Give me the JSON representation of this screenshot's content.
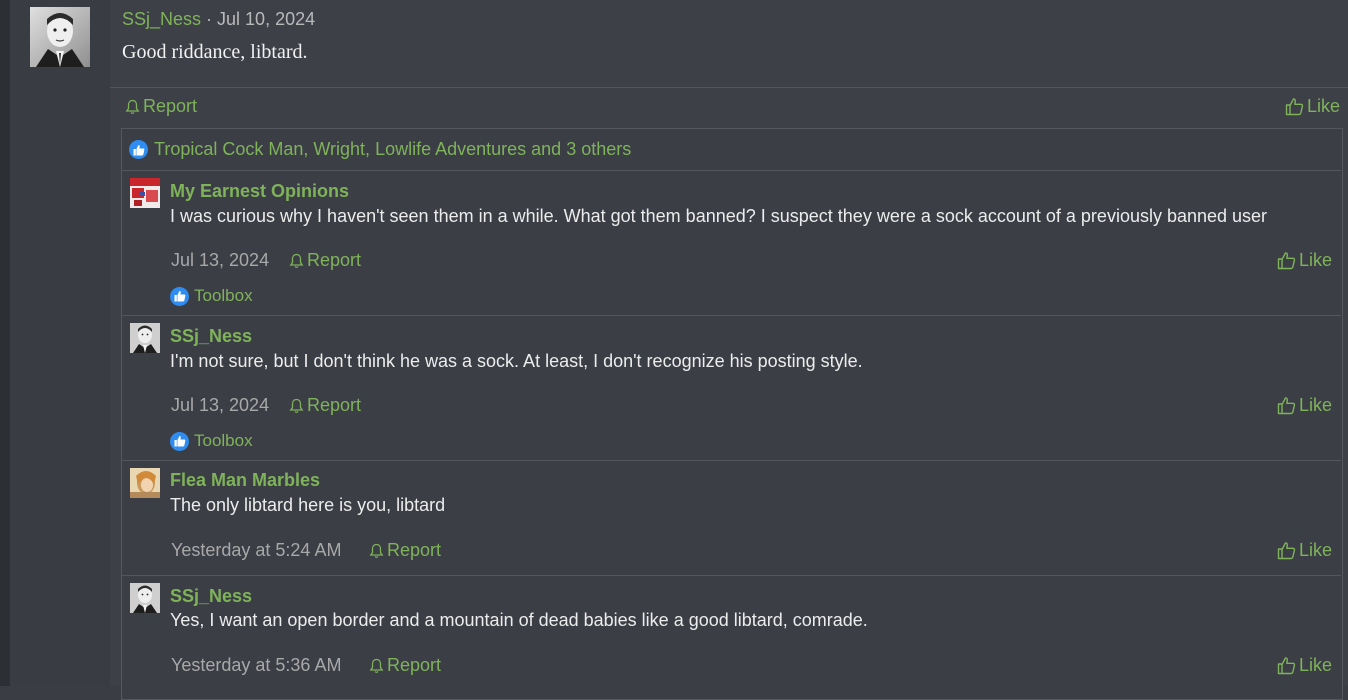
{
  "post": {
    "author": "SSj_Ness",
    "separator": " · ",
    "date": "Jul 10, 2024",
    "body": "Good riddance, libtard.",
    "report_label": "Report",
    "like_label": "Like"
  },
  "likes_summary": {
    "text": "Tropical Cock Man, Wright, Lowlife Adventures and 3 others"
  },
  "comments": [
    {
      "author": "My Earnest Opinions",
      "text": "I was curious why I haven't seen them in a while. What got them banned? I suspect they were a sock account of a previously banned user",
      "date": "Jul 13, 2024",
      "report_label": "Report",
      "like_label": "Like",
      "liker": "Toolbox"
    },
    {
      "author": "SSj_Ness",
      "text": "I'm not sure, but I don't think he was a sock. At least, I don't recognize his posting style.",
      "date": "Jul 13, 2024",
      "report_label": "Report",
      "like_label": "Like",
      "liker": "Toolbox"
    },
    {
      "author": "Flea Man Marbles",
      "text": "The only libtard here is you, libtard",
      "date": "Yesterday at 5:24 AM",
      "report_label": "Report",
      "like_label": "Like"
    },
    {
      "author": "SSj_Ness",
      "text": "Yes, I want an open border and a mountain of dead babies like a good libtard, comrade.",
      "date": "Yesterday at 5:36 AM",
      "report_label": "Report",
      "like_label": "Like"
    }
  ],
  "colors": {
    "accent": "#7fb35a",
    "like_badge": "#2f8cf0",
    "background": "#3a3d43"
  }
}
